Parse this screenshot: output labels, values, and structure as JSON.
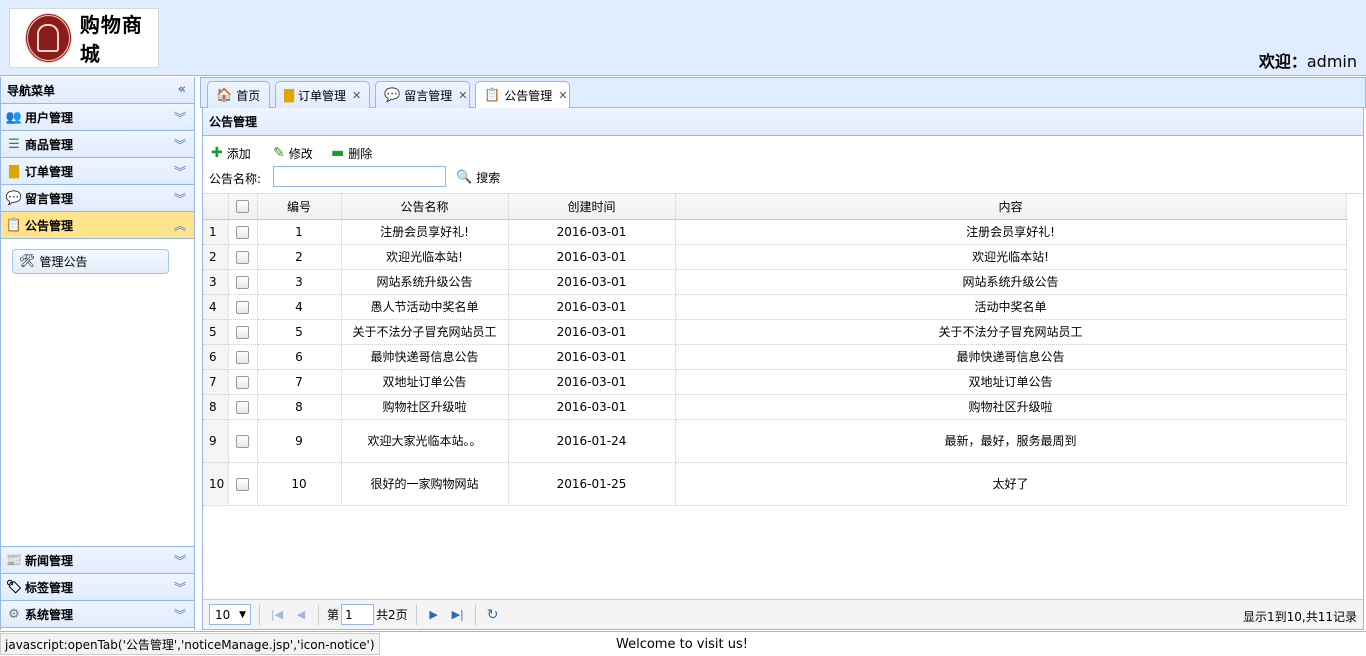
{
  "header": {
    "logo_text": "购物商城",
    "welcome_label": "欢迎：",
    "welcome_user": "admin"
  },
  "sidebar": {
    "title": "导航菜单",
    "collapse_icon": "double-chevron-left-icon",
    "items_top": [
      {
        "label": "用户管理",
        "icon": "users-icon"
      },
      {
        "label": "商品管理",
        "icon": "list-icon"
      },
      {
        "label": "订单管理",
        "icon": "folder-icon"
      },
      {
        "label": "留言管理",
        "icon": "speech-bubble-icon"
      },
      {
        "label": "公告管理",
        "icon": "notice-icon"
      }
    ],
    "sub_item": {
      "label": "管理公告",
      "icon": "tools-icon"
    },
    "items_bottom": [
      {
        "label": "新闻管理",
        "icon": "newspaper-icon"
      },
      {
        "label": "标签管理",
        "icon": "tag-icon"
      },
      {
        "label": "系统管理",
        "icon": "gear-icon"
      }
    ]
  },
  "tabs": [
    {
      "label": "首页",
      "icon": "home-icon",
      "closable": false
    },
    {
      "label": "订单管理",
      "icon": "folder-icon",
      "closable": true
    },
    {
      "label": "留言管理",
      "icon": "speech-bubble-icon",
      "closable": true
    },
    {
      "label": "公告管理",
      "icon": "notice-icon",
      "closable": true
    }
  ],
  "panel": {
    "title": "公告管理"
  },
  "toolbar": {
    "add_label": "添加",
    "edit_label": "修改",
    "delete_label": "删除",
    "search_label": "公告名称:",
    "search_value": "",
    "search_button": "搜索"
  },
  "grid": {
    "columns": [
      "编号",
      "公告名称",
      "创建时间",
      "内容"
    ],
    "rows": [
      {
        "n": "1",
        "id": "1",
        "name": "注册会员享好礼!",
        "date": "2016-03-01",
        "content": "注册会员享好礼!"
      },
      {
        "n": "2",
        "id": "2",
        "name": "欢迎光临本站!",
        "date": "2016-03-01",
        "content": "欢迎光临本站!"
      },
      {
        "n": "3",
        "id": "3",
        "name": "网站系统升级公告",
        "date": "2016-03-01",
        "content": "网站系统升级公告"
      },
      {
        "n": "4",
        "id": "4",
        "name": "愚人节活动中奖名单",
        "date": "2016-03-01",
        "content": "活动中奖名单"
      },
      {
        "n": "5",
        "id": "5",
        "name": "关于不法分子冒充网站员工",
        "date": "2016-03-01",
        "content": "关于不法分子冒充网站员工"
      },
      {
        "n": "6",
        "id": "6",
        "name": "最帅快递哥信息公告",
        "date": "2016-03-01",
        "content": "最帅快递哥信息公告"
      },
      {
        "n": "7",
        "id": "7",
        "name": "双地址订单公告",
        "date": "2016-03-01",
        "content": "双地址订单公告"
      },
      {
        "n": "8",
        "id": "8",
        "name": "购物社区升级啦",
        "date": "2016-03-01",
        "content": "购物社区升级啦"
      },
      {
        "n": "9",
        "id": "9",
        "name": "欢迎大家光临本站。。",
        "date": "2016-01-24",
        "content": "最新，最好，服务最周到"
      },
      {
        "n": "10",
        "id": "10",
        "name": "很好的一家购物网站",
        "date": "2016-01-25",
        "content": "太好了"
      }
    ]
  },
  "pager": {
    "page_size": "10",
    "page_prefix": "第",
    "page_value": "1",
    "page_total": "共2页",
    "info": "显示1到10,共11记录"
  },
  "statusbar": {
    "url": "javascript:openTab('公告管理','noticeManage.jsp','icon-notice')",
    "message": "Welcome to visit us!"
  },
  "colors": {
    "header_bg": "#e0ecff",
    "border": "#95b8e7",
    "selected_accordion": "#ffe48d"
  }
}
